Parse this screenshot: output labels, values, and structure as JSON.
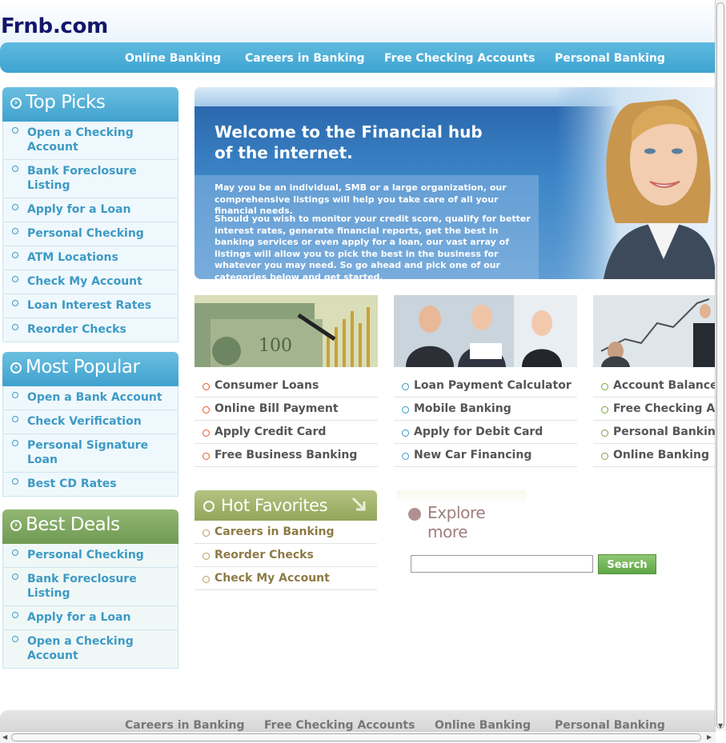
{
  "site": {
    "logo": "Frnb.com"
  },
  "top_nav": [
    {
      "label": "Online Banking"
    },
    {
      "label": "Careers in Banking"
    },
    {
      "label": "Free Checking Accounts"
    },
    {
      "label": "Personal Banking"
    }
  ],
  "top_picks": {
    "title": "Top Picks",
    "items": [
      "Open a Checking Account",
      "Bank Foreclosure Listing",
      "Apply for a Loan",
      "Personal Checking",
      "ATM Locations",
      "Check My Account",
      "Loan Interest Rates",
      "Reorder Checks"
    ]
  },
  "most_popular": {
    "title": "Most Popular",
    "items": [
      "Open a Bank Account",
      "Check Verification",
      "Personal Signature Loan",
      "Best CD Rates"
    ]
  },
  "best_deals": {
    "title": "Best Deals",
    "items": [
      "Personal Checking",
      "Bank Foreclosure Listing",
      "Apply for a Loan",
      "Open a Checking Account"
    ]
  },
  "hero": {
    "title_line1": "Welcome to the Financial hub",
    "title_line2": "of the internet.",
    "para1": "May you be an individual, SMB or a large organization, our comprehensive listings will help you take care of all your financial needs.",
    "para2": "Should you wish to monitor your credit score, qualify for better interest rates, generate financial reports, get the best in banking services or even apply for a loan, our vast array of listings will allow you to pick the best in the business for whatever you may need. So go ahead and pick one of our categories below and get started."
  },
  "columns": [
    {
      "items": [
        "Consumer Loans",
        "Online Bill Payment",
        "Apply Credit Card",
        "Free Business Banking"
      ],
      "bullet_color": "#e8582a"
    },
    {
      "items": [
        "Loan Payment Calculator",
        "Mobile Banking",
        "Apply for Debit Card",
        "New Car Financing"
      ],
      "bullet_color": "#3d9ac5"
    },
    {
      "items": [
        "Account Balance",
        "Free Checking Acc",
        "Personal Banking",
        "Online Banking"
      ],
      "bullet_color": "#7aa53f"
    }
  ],
  "hot_favorites": {
    "title": "Hot Favorites",
    "items": [
      "Careers in Banking",
      "Reorder Checks",
      "Check My Account"
    ]
  },
  "explore": {
    "title": "Explore more"
  },
  "search": {
    "value": "",
    "button_label": "Search"
  },
  "footer_nav": [
    {
      "label": "Careers in Banking"
    },
    {
      "label": "Free Checking Accounts"
    },
    {
      "label": "Online Banking"
    },
    {
      "label": "Personal Banking"
    }
  ]
}
